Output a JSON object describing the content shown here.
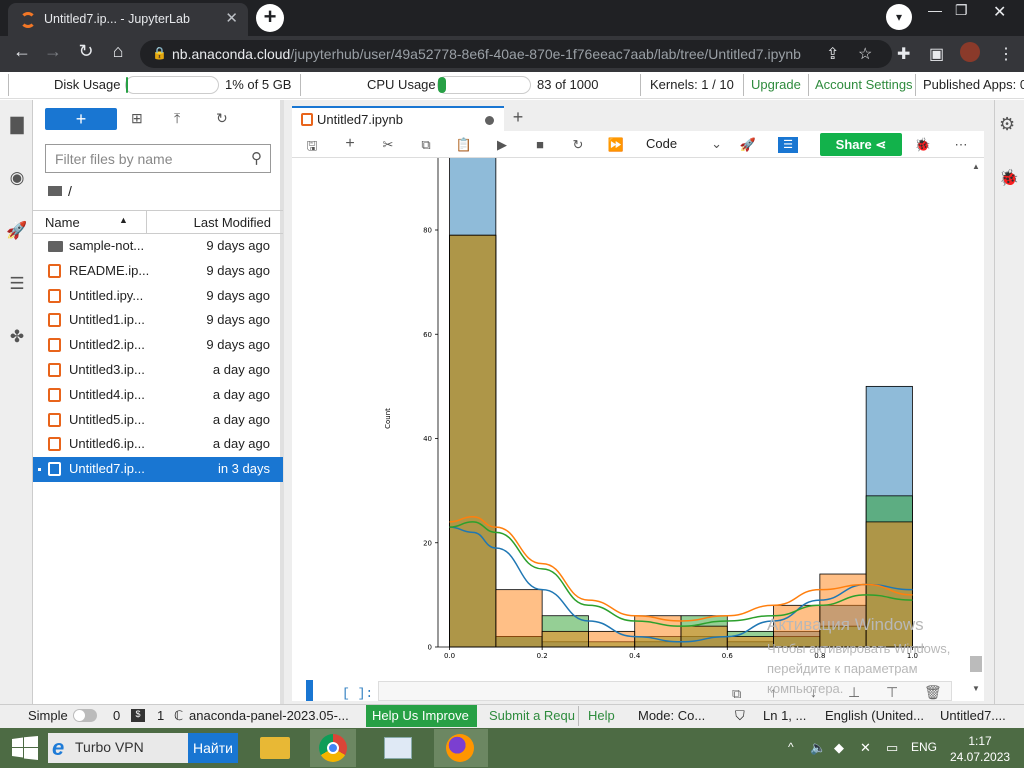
{
  "browser": {
    "tab_title": "Untitled7.ip... - JupyterLab",
    "url_host": "nb.anaconda.cloud",
    "url_path": "/jupyterhub/user/49a52778-8e6f-40ae-870e-1f76eeac7aab/lab/tree/Untitled7.ipynb"
  },
  "topbar": {
    "disk_label": "Disk Usage",
    "disk_value": "1% of 5 GB",
    "disk_fraction": 0.01,
    "cpu_label": "CPU Usage",
    "cpu_value": "83 of 1000",
    "cpu_fraction": 0.083,
    "kernels": "Kernels: 1 / 10",
    "upgrade": "Upgrade",
    "account": "Account Settings",
    "published": "Published Apps: 0"
  },
  "filebrowser": {
    "filter_placeholder": "Filter files by name",
    "breadcrumb": "/",
    "col_name": "Name",
    "col_modified": "Last Modified",
    "files": [
      {
        "name": "sample-not...",
        "modified": "9 days ago",
        "type": "folder"
      },
      {
        "name": "README.ip...",
        "modified": "9 days ago",
        "type": "notebook"
      },
      {
        "name": "Untitled.ipy...",
        "modified": "9 days ago",
        "type": "notebook"
      },
      {
        "name": "Untitled1.ip...",
        "modified": "9 days ago",
        "type": "notebook"
      },
      {
        "name": "Untitled2.ip...",
        "modified": "9 days ago",
        "type": "notebook"
      },
      {
        "name": "Untitled3.ip...",
        "modified": "a day ago",
        "type": "notebook"
      },
      {
        "name": "Untitled4.ip...",
        "modified": "a day ago",
        "type": "notebook"
      },
      {
        "name": "Untitled5.ip...",
        "modified": "a day ago",
        "type": "notebook"
      },
      {
        "name": "Untitled6.ip...",
        "modified": "a day ago",
        "type": "notebook"
      },
      {
        "name": "Untitled7.ip...",
        "modified": "in 3 days",
        "type": "notebook",
        "selected": true
      }
    ]
  },
  "notebook": {
    "tab_name": "Untitled7.ipynb",
    "kernel_select": "Code",
    "share_label": "Share",
    "next_cell_prompt": "[ ]:"
  },
  "chart_data": {
    "type": "bar",
    "ylabel": "Count",
    "xlabel": "",
    "ylim": [
      0,
      80
    ],
    "y_ticks": [
      "0",
      "20",
      "40",
      "60",
      "80"
    ],
    "x_ticks": [
      "0.0",
      "0.2",
      "0.4",
      "0.6",
      "0.8",
      "1.0"
    ],
    "x_tick_values": [
      0,
      0.2,
      0.4,
      0.6,
      0.8,
      1.0
    ],
    "bin_edges": [
      0,
      0.1,
      0.2,
      0.3,
      0.4,
      0.5,
      0.6,
      0.7,
      0.8,
      0.9,
      1.0
    ],
    "series": [
      {
        "values": [
          94,
          2,
          1,
          0,
          1,
          2,
          1,
          3,
          8,
          50
        ],
        "color": "#1f77b4"
      },
      {
        "values": [
          79,
          2,
          6,
          1,
          2,
          6,
          3,
          2,
          4,
          29
        ],
        "color": "#2ca02c"
      },
      {
        "values": [
          79,
          11,
          3,
          3,
          6,
          4,
          2,
          8,
          14,
          24
        ],
        "color": "#ff7f0e"
      }
    ],
    "kde": [
      {
        "color": "#1f77b4",
        "points": [
          [
            0,
            23
          ],
          [
            0.05,
            22
          ],
          [
            0.1,
            19
          ],
          [
            0.2,
            11
          ],
          [
            0.3,
            5
          ],
          [
            0.4,
            2
          ],
          [
            0.5,
            1
          ],
          [
            0.6,
            2
          ],
          [
            0.7,
            5
          ],
          [
            0.8,
            9
          ],
          [
            0.9,
            12
          ],
          [
            1.0,
            11
          ]
        ]
      },
      {
        "color": "#2ca02c",
        "points": [
          [
            0,
            23
          ],
          [
            0.05,
            24
          ],
          [
            0.1,
            22
          ],
          [
            0.2,
            15
          ],
          [
            0.3,
            8
          ],
          [
            0.4,
            5
          ],
          [
            0.5,
            4
          ],
          [
            0.6,
            5
          ],
          [
            0.7,
            6
          ],
          [
            0.8,
            8
          ],
          [
            0.9,
            10
          ],
          [
            1.0,
            9
          ]
        ]
      },
      {
        "color": "#ff7f0e",
        "points": [
          [
            0,
            24
          ],
          [
            0.05,
            25
          ],
          [
            0.1,
            23
          ],
          [
            0.2,
            16
          ],
          [
            0.3,
            9
          ],
          [
            0.4,
            6
          ],
          [
            0.5,
            5
          ],
          [
            0.6,
            6
          ],
          [
            0.7,
            8
          ],
          [
            0.8,
            11
          ],
          [
            0.9,
            12
          ],
          [
            1.0,
            10
          ]
        ]
      }
    ]
  },
  "watermark": {
    "line1": "Активация Windows",
    "line2": "Чтобы активировать Windows,",
    "line3": "перейдите к параметрам",
    "line4": "компьютера."
  },
  "statusbar": {
    "mode_simple": "Simple",
    "count0": "0",
    "count1": "1",
    "env": "anaconda-panel-2023.05-...",
    "help_improve": "Help Us Improve",
    "submit": "Submit a Requ",
    "help": "Help",
    "mode": "Mode: Co...",
    "position": "Ln 1, ...",
    "language": "English (United...",
    "file": "Untitled7...."
  },
  "taskbar": {
    "search_text": "Turbo VPN",
    "find_button": "Найти",
    "lang": "ENG",
    "time": "1:17",
    "date": "24.07.2023"
  }
}
